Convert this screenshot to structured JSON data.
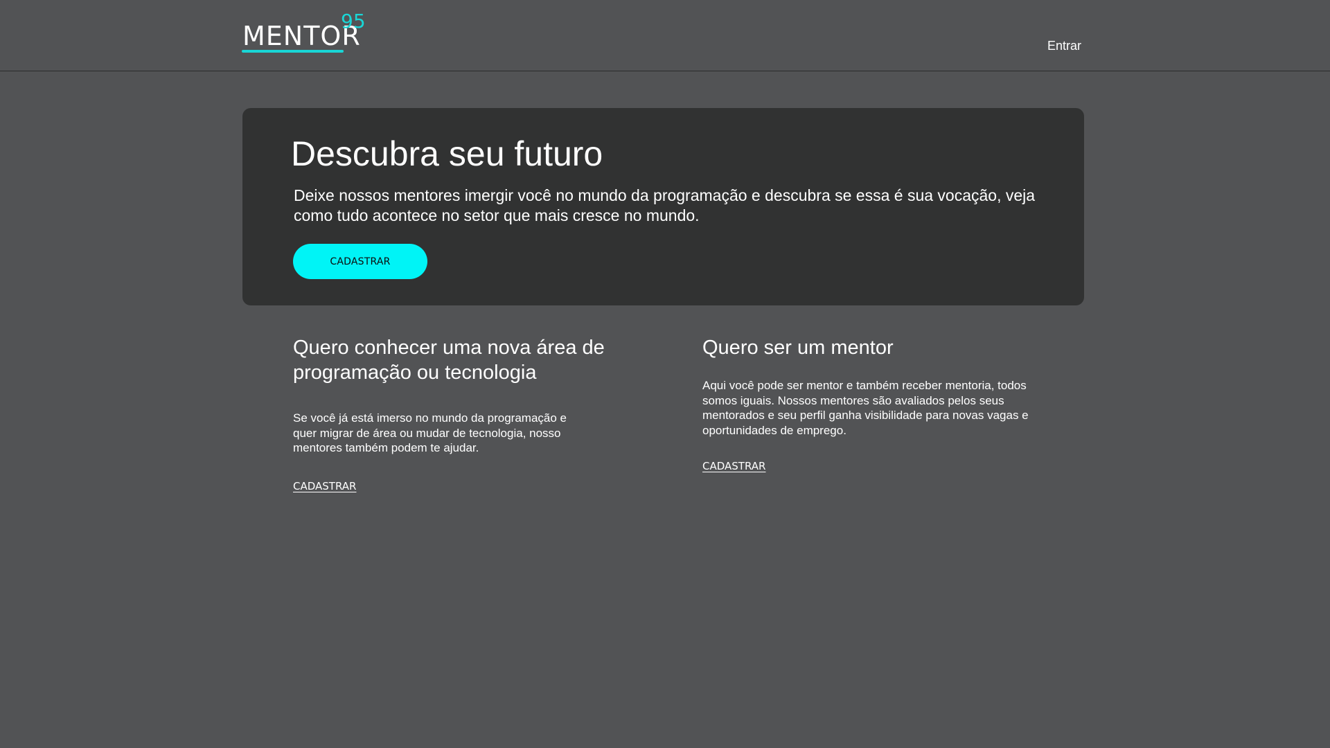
{
  "header": {
    "logo": {
      "word": "MENTOR",
      "superscript": "95"
    },
    "login_label": "Entrar"
  },
  "hero": {
    "title": "Descubra seu futuro",
    "text": "Deixe nossos mentores imergir você no mundo da programação e descubra se essa é sua vocação, veja como tudo acontece no setor que mais cresce no mundo.",
    "button_label": "CADASTRAR"
  },
  "sections": [
    {
      "title": "Quero conhecer uma nova área de programação ou tecnologia",
      "text": "Se você já está imerso no mundo da programação e quer migrar de área ou mudar de tecnologia, nosso mentores também podem te ajudar.",
      "link_label": "CADASTRAR"
    },
    {
      "title": "Quero ser um mentor",
      "text": "Aqui você pode ser mentor e também receber mentoria, todos somos iguais. Nossos mentores são avaliados pelos seus mentorados e seu perfil ganha visibilidade para novas vagas e oportunidades de emprego.",
      "link_label": "CADASTRAR"
    }
  ],
  "colors": {
    "background": "#525355",
    "hero_background": "#313232",
    "accent": "#00f4f6",
    "logo_accent": "#19d6d6",
    "text": "#ffffff"
  }
}
